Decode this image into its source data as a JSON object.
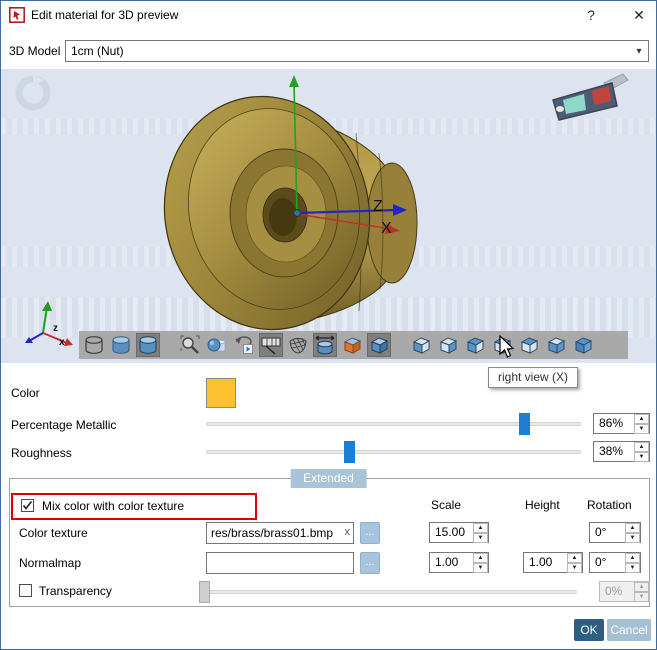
{
  "window": {
    "title": "Edit material for 3D preview"
  },
  "icons": {
    "help": "?",
    "close": "✕",
    "dropdown": "▾",
    "spin_up": "▲",
    "spin_down": "▼",
    "clear": "x",
    "browse": "...",
    "app_icon": "red-arrow-app-icon"
  },
  "model_row": {
    "label": "3D Model",
    "value": "1cm (Nut)"
  },
  "preview": {
    "tooltip": "right view (X)",
    "axis_z_label": "Z",
    "axis_x_label": "X",
    "gizmo_z_label": "z",
    "gizmo_x_label": "x",
    "background_color": "#dde4ef",
    "model_description": "brass nut 3D model",
    "toolbar_icons": [
      "wireframe-cylinder",
      "shaded-cylinder",
      "shaded-cylinder-active",
      "zoom-fit",
      "sphere-preview",
      "rotate-animation",
      "viewport-grid-active",
      "wire-basket",
      "fit-cylinder-active",
      "textured-box",
      "edged-cube-active",
      "view-cube-front",
      "view-cube-back",
      "view-cube-left",
      "view-cube-right",
      "view-cube-top",
      "view-cube-bottom",
      "view-cube-iso"
    ]
  },
  "material": {
    "color_label": "Color",
    "color_hex": "#fdc02f",
    "metallic_label": "Percentage Metallic",
    "metallic_value": "86%",
    "metallic_pct": 86,
    "roughness_label": "Roughness",
    "roughness_value": "38%",
    "roughness_pct": 38,
    "slider_accent": "#1b7fd6"
  },
  "extended": {
    "tab_label": "Extended",
    "mix_checkbox_label": "Mix color with color texture",
    "mix_checked": true,
    "headers": {
      "scale": "Scale",
      "height": "Height",
      "rotation": "Rotation"
    },
    "color_texture": {
      "label": "Color texture",
      "value": "res/brass/brass01.bmp",
      "scale": "15.00",
      "rotation": "0°"
    },
    "normalmap": {
      "label": "Normalmap",
      "value": "",
      "scale": "1.00",
      "height": "1.00",
      "rotation": "0°"
    },
    "transparency": {
      "label": "Transparency",
      "checked": false,
      "value": "0%",
      "pct": 0
    }
  },
  "footer": {
    "ok": "OK",
    "cancel": "Cancel"
  }
}
